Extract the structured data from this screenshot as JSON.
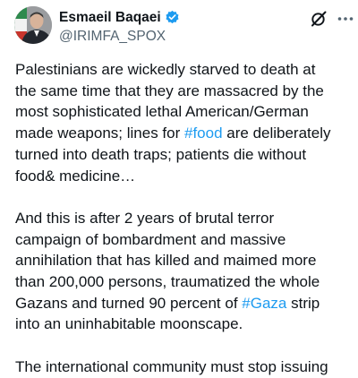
{
  "author": {
    "display_name": "Esmaeil Baqaei",
    "handle": "@IRIMFA_SPOX",
    "verified_color": "#1d9bf0",
    "avatar_icon": "avatar"
  },
  "actions": {
    "grok_icon": "grok-icon",
    "more_icon": "more-icon"
  },
  "hashtag_color": "#1d9bf0",
  "tweet": {
    "p1": {
      "l1": "Palestinians are wickedly starved to death at",
      "l2": "the same time that they are massacred by the",
      "l3": "most sophisticated lethal American/German",
      "l4_pre": "made weapons; lines for ",
      "l4_tag": "#food",
      "l4_post": " are deliberately",
      "l5": "turned into death traps; patients die without",
      "l6": "food& medicine…"
    },
    "p2": {
      "l1": "And this is after 2 years of brutal terror",
      "l2": "campaign of bombardment and massive",
      "l3": "annihilation that has killed and maimed more",
      "l4": "than 200,000 persons, traumatized the whole",
      "l5_pre": "Gazans and turned 90 percent of ",
      "l5_tag": "#Gaza",
      "l5_post": " strip",
      "l6": "into an uninhabitable moonscape."
    },
    "p3": {
      "l1": "The international community must stop issuing"
    }
  }
}
